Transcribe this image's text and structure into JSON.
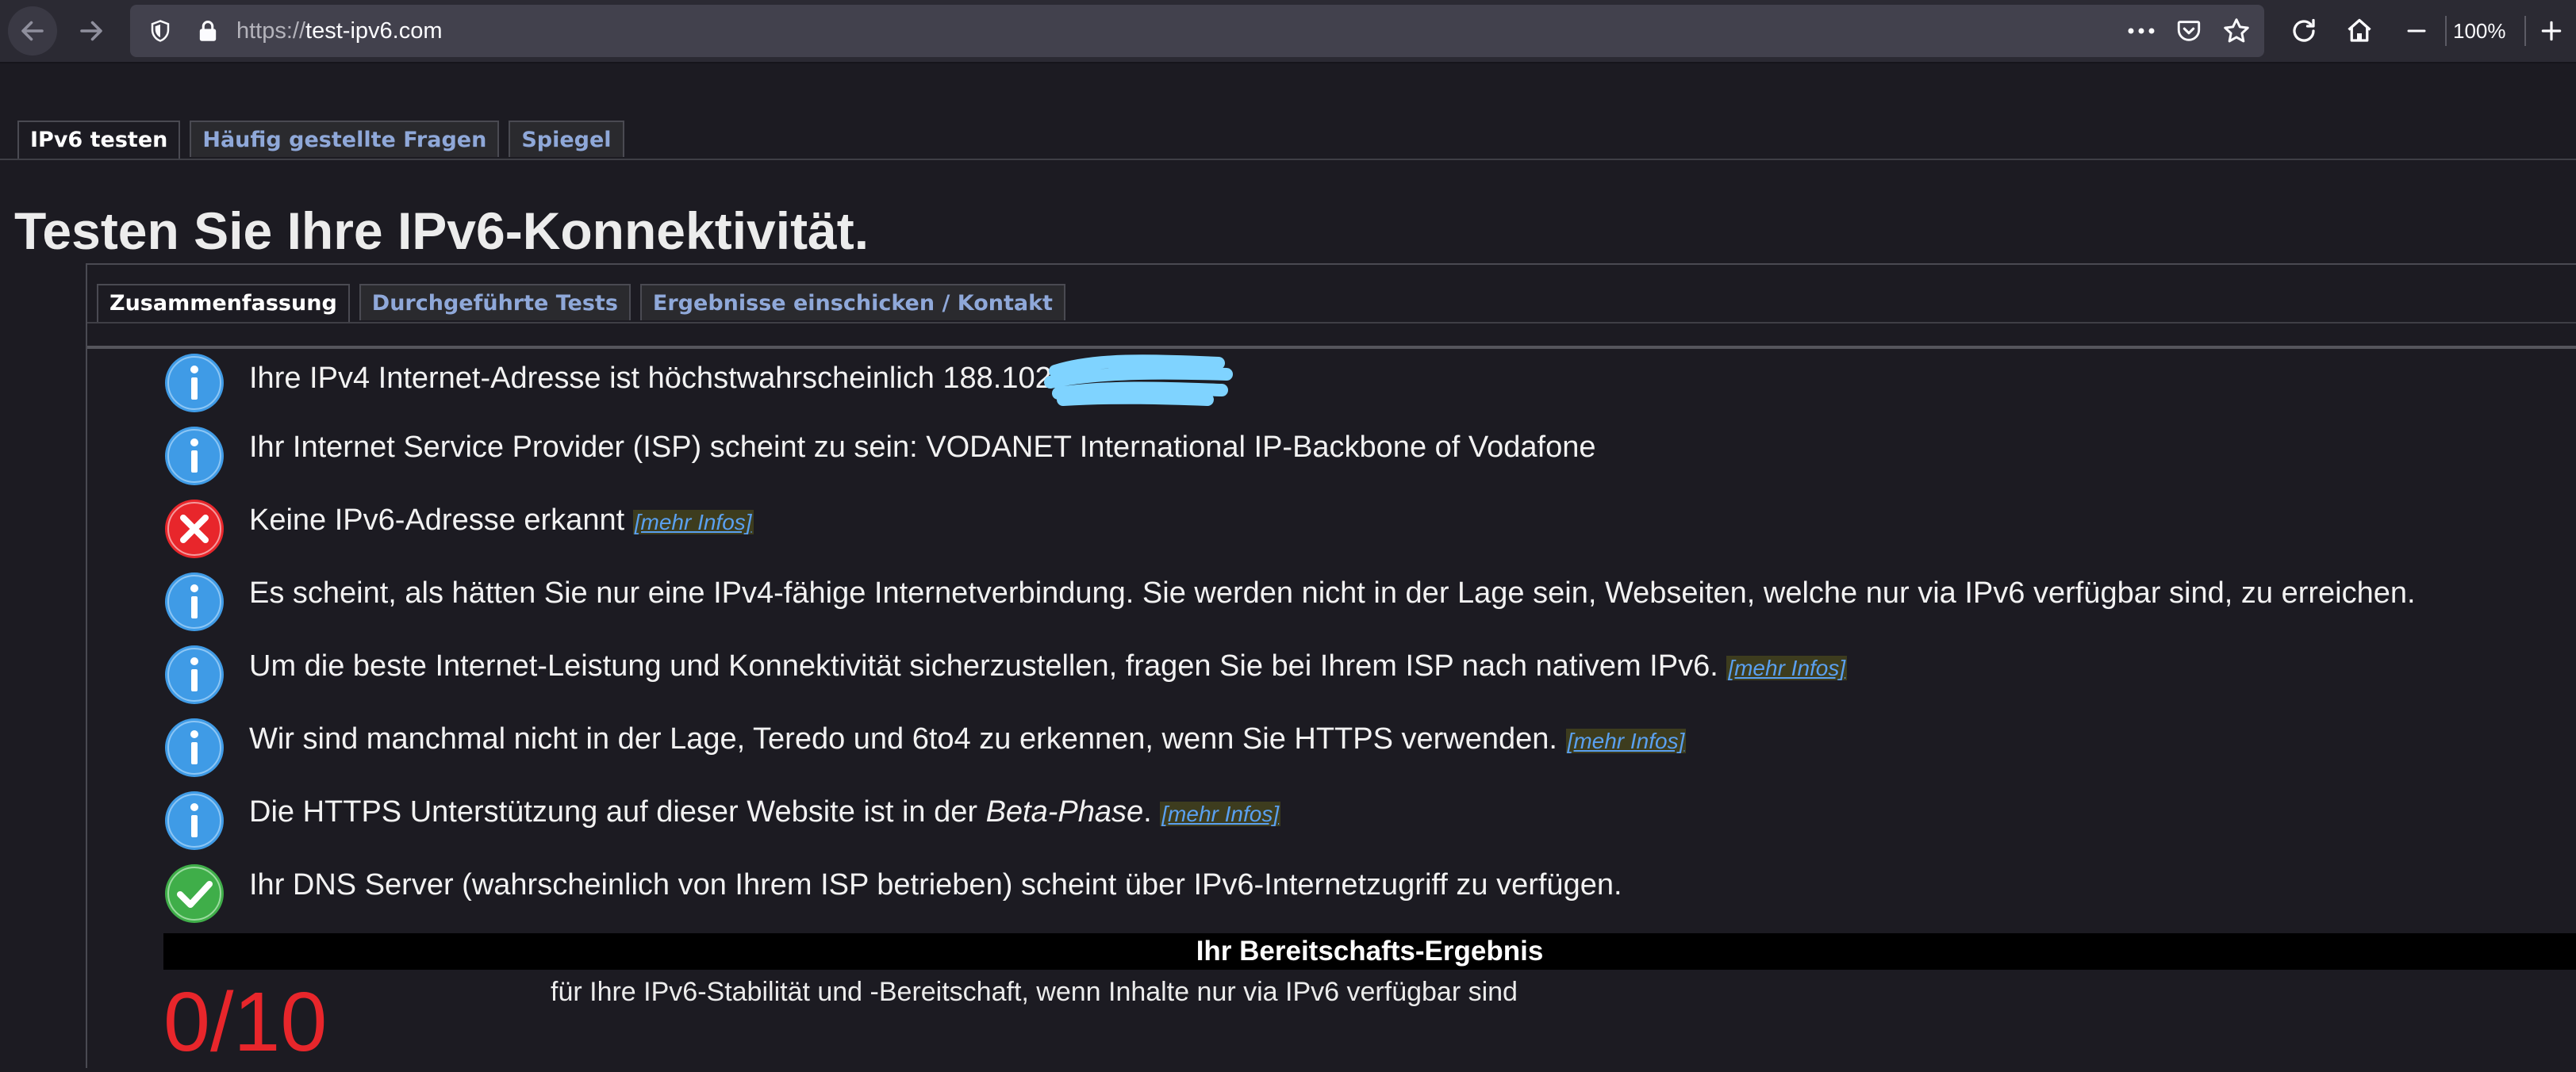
{
  "browser": {
    "url_scheme": "https://",
    "url_host": "test-ipv6.com",
    "zoom": "100%"
  },
  "top_tabs": [
    {
      "label": "IPv6 testen",
      "active": true
    },
    {
      "label": "Häufig gestellte Fragen",
      "active": false
    },
    {
      "label": "Spiegel",
      "active": false
    }
  ],
  "page_title": "Testen Sie Ihre IPv6-Konnektivität.",
  "sub_tabs": [
    {
      "label": "Zusammenfassung",
      "active": true
    },
    {
      "label": "Durchgeführte Tests",
      "active": false
    },
    {
      "label": "Ergebnisse einschicken / Kontakt",
      "active": false
    }
  ],
  "messages": [
    {
      "icon": "info-icon",
      "text": "Ihre IPv4 Internet-Adresse ist höchstwahrscheinlich 188.102."
    },
    {
      "icon": "info-icon",
      "text": "Ihr Internet Service Provider (ISP) scheint zu sein: VODANET International IP-Backbone of Vodafone"
    },
    {
      "icon": "error-icon",
      "text": "Keine IPv6-Adresse erkannt",
      "more": "[mehr Infos]"
    },
    {
      "icon": "info-icon",
      "text": "Es scheint, als hätten Sie nur eine IPv4-fähige Internetverbindung. Sie werden nicht in der Lage sein, Webseiten, welche nur via IPv6 verfügbar sind, zu erreichen."
    },
    {
      "icon": "info-icon",
      "text": "Um die beste Internet-Leistung und Konnektivität sicherzustellen, fragen Sie bei Ihrem ISP nach nativem IPv6.",
      "more": "[mehr Infos]"
    },
    {
      "icon": "info-icon",
      "text": "Wir sind manchmal nicht in der Lage, Teredo und 6to4 zu erkennen, wenn Sie HTTPS verwenden.",
      "more": "[mehr Infos]"
    },
    {
      "icon": "info-icon",
      "text_before": "Die HTTPS Unterstützung auf dieser Website ist in der ",
      "text_em": "Beta-Phase",
      "text_after": ".",
      "more": "[mehr Infos]"
    },
    {
      "icon": "check-icon",
      "text": "Ihr DNS Server (wahrscheinlich von Ihrem ISP betrieben) scheint über IPv6-Internetzugriff zu verfügen."
    }
  ],
  "readiness": {
    "heading": "Ihr Bereitschafts-Ergebnis",
    "score": "0/10",
    "description": "für Ihre IPv6-Stabilität und -Bereitschaft, wenn Inhalte nur via IPv6 verfügbar sind"
  },
  "colors": {
    "info": "#3f9be6",
    "error": "#e8262b",
    "success": "#3fae49",
    "score": "#e8262b"
  }
}
